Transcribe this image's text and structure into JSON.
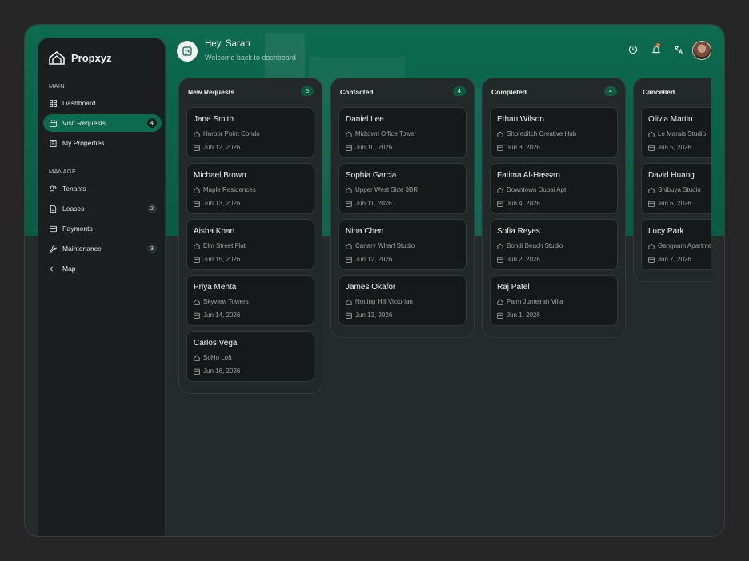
{
  "app": {
    "brand": "Propxyz"
  },
  "sidebar": {
    "main_label": "MAIN",
    "manage_label": "MANAGE",
    "main_items": [
      {
        "label": "Dashboard",
        "icon": "grid-icon"
      },
      {
        "label": "Visit Requests",
        "icon": "calendar-icon",
        "badge": "4",
        "active": true
      },
      {
        "label": "My Properties",
        "icon": "building-icon"
      }
    ],
    "manage_items": [
      {
        "label": "Tenants",
        "icon": "users-icon"
      },
      {
        "label": "Leases",
        "icon": "document-icon",
        "badge": "2"
      },
      {
        "label": "Payments",
        "icon": "card-icon"
      },
      {
        "label": "Maintenance",
        "icon": "wrench-icon",
        "badge": "3"
      },
      {
        "label": "Map",
        "icon": "arrow-left-icon"
      }
    ]
  },
  "header": {
    "greeting": "Hey, Sarah",
    "subtitle": "Welcome back to dashboard",
    "icons": [
      "clock-icon",
      "bell-icon",
      "translate-icon"
    ]
  },
  "colors": {
    "accent": "#0c6a4e",
    "surface": "#1b1e1f",
    "card": "#16191a",
    "notification": "#e56b4f"
  },
  "columns": [
    {
      "title": "New Requests",
      "count": "5",
      "cards": [
        {
          "name": "Jane Smith",
          "property": "Harbor Point Condo",
          "date": "Jun 12, 2026"
        },
        {
          "name": "Michael Brown",
          "property": "Maple Residences",
          "date": "Jun 13, 2026"
        },
        {
          "name": "Aisha Khan",
          "property": "Elm Street Flat",
          "date": "Jun 15, 2026"
        },
        {
          "name": "Priya Mehta",
          "property": "Skyview Towers",
          "date": "Jun 14, 2026"
        },
        {
          "name": "Carlos Vega",
          "property": "SoHo Loft",
          "date": "Jun 16, 2026"
        }
      ]
    },
    {
      "title": "Contacted",
      "count": "4",
      "cards": [
        {
          "name": "Daniel Lee",
          "property": "Midtown Office Tower",
          "date": "Jun 10, 2026"
        },
        {
          "name": "Sophia Garcia",
          "property": "Upper West Side 3BR",
          "date": "Jun 11, 2026"
        },
        {
          "name": "Nina Chen",
          "property": "Canary Wharf Studio",
          "date": "Jun 12, 2026"
        },
        {
          "name": "James Okafor",
          "property": "Notting Hill Victorian",
          "date": "Jun 13, 2026"
        }
      ]
    },
    {
      "title": "Completed",
      "count": "4",
      "cards": [
        {
          "name": "Ethan Wilson",
          "property": "Shoreditch Creative Hub",
          "date": "Jun 3, 2026"
        },
        {
          "name": "Fatima Al-Hassan",
          "property": "Downtown Dubai Apt",
          "date": "Jun 4, 2026"
        },
        {
          "name": "Sofia Reyes",
          "property": "Bondi Beach Studio",
          "date": "Jun 2, 2026"
        },
        {
          "name": "Raj Patel",
          "property": "Palm Jumeirah Villa",
          "date": "Jun 1, 2026"
        }
      ]
    },
    {
      "title": "Cancelled",
      "count": "",
      "cards": [
        {
          "name": "Olivia Martin",
          "property": "Le Marais Studio",
          "date": "Jun 5, 2026"
        },
        {
          "name": "David Huang",
          "property": "Shibuya Studio",
          "date": "Jun 6, 2026"
        },
        {
          "name": "Lucy Park",
          "property": "Gangnam Apartment",
          "date": "Jun 7, 2026"
        }
      ]
    }
  ]
}
